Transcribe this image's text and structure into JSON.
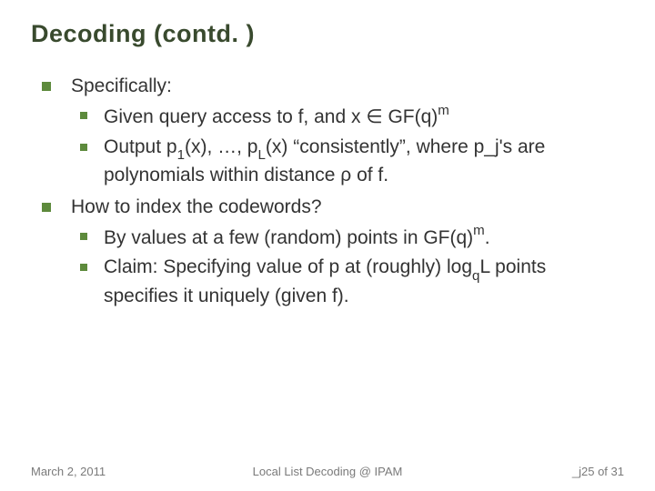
{
  "title": "Decoding (contd. )",
  "bullets": {
    "b1": {
      "text": "Specifically:"
    },
    "b1a": {
      "pre": "Given query access to f, and x ",
      "elem": "∈",
      "post1": " GF(q)",
      "sup": "m"
    },
    "b1b": {
      "s1": "Output p",
      "sub1": "1",
      "s2": "(x), …, p",
      "sub2": "L",
      "s3": "(x) “consistently”, where p_j's are polynomials within distance ρ of f."
    },
    "b2": {
      "text": "How to index the codewords?"
    },
    "b2a": {
      "s1": "By values at a few (random) points in GF(q)",
      "sup": "m",
      "s2": "."
    },
    "b2b": {
      "s1": "Claim: Specifying value of p at (roughly) log",
      "sub": "q",
      "s2": "L points specifies it uniquely (given f)."
    }
  },
  "footer": {
    "left": "March 2, 2011",
    "center": "Local List Decoding @ IPAM",
    "right_pre": "_j",
    "right_page": "25",
    "right_of": " of 31"
  }
}
